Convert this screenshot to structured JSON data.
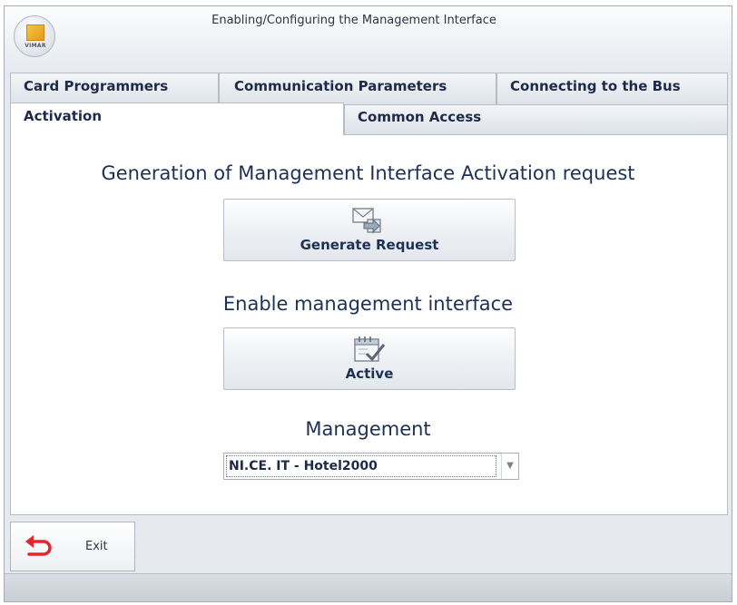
{
  "window": {
    "title": "Enabling/Configuring the Management Interface",
    "app_logo_text": "VIMAR"
  },
  "tabs": {
    "row1": [
      {
        "label": "Card Programmers"
      },
      {
        "label": "Communication Parameters"
      },
      {
        "label": "Connecting to the Bus"
      }
    ],
    "row2": [
      {
        "label": "Activation",
        "active": true
      },
      {
        "label": "Common Access"
      }
    ]
  },
  "activation": {
    "request_heading": "Generation of Management Interface Activation request",
    "generate_button": {
      "label": "Generate Request",
      "icon": "envelope-arrow-icon"
    },
    "enable_heading": "Enable management interface",
    "active_button": {
      "label": "Active",
      "icon": "calendar-check-icon"
    },
    "management_heading": "Management",
    "management_select": {
      "value": "NI.CE. IT - Hotel2000"
    }
  },
  "footer": {
    "exit_button": {
      "label": "Exit",
      "icon": "undo-arrow-icon",
      "icon_color": "#e3262b"
    }
  }
}
